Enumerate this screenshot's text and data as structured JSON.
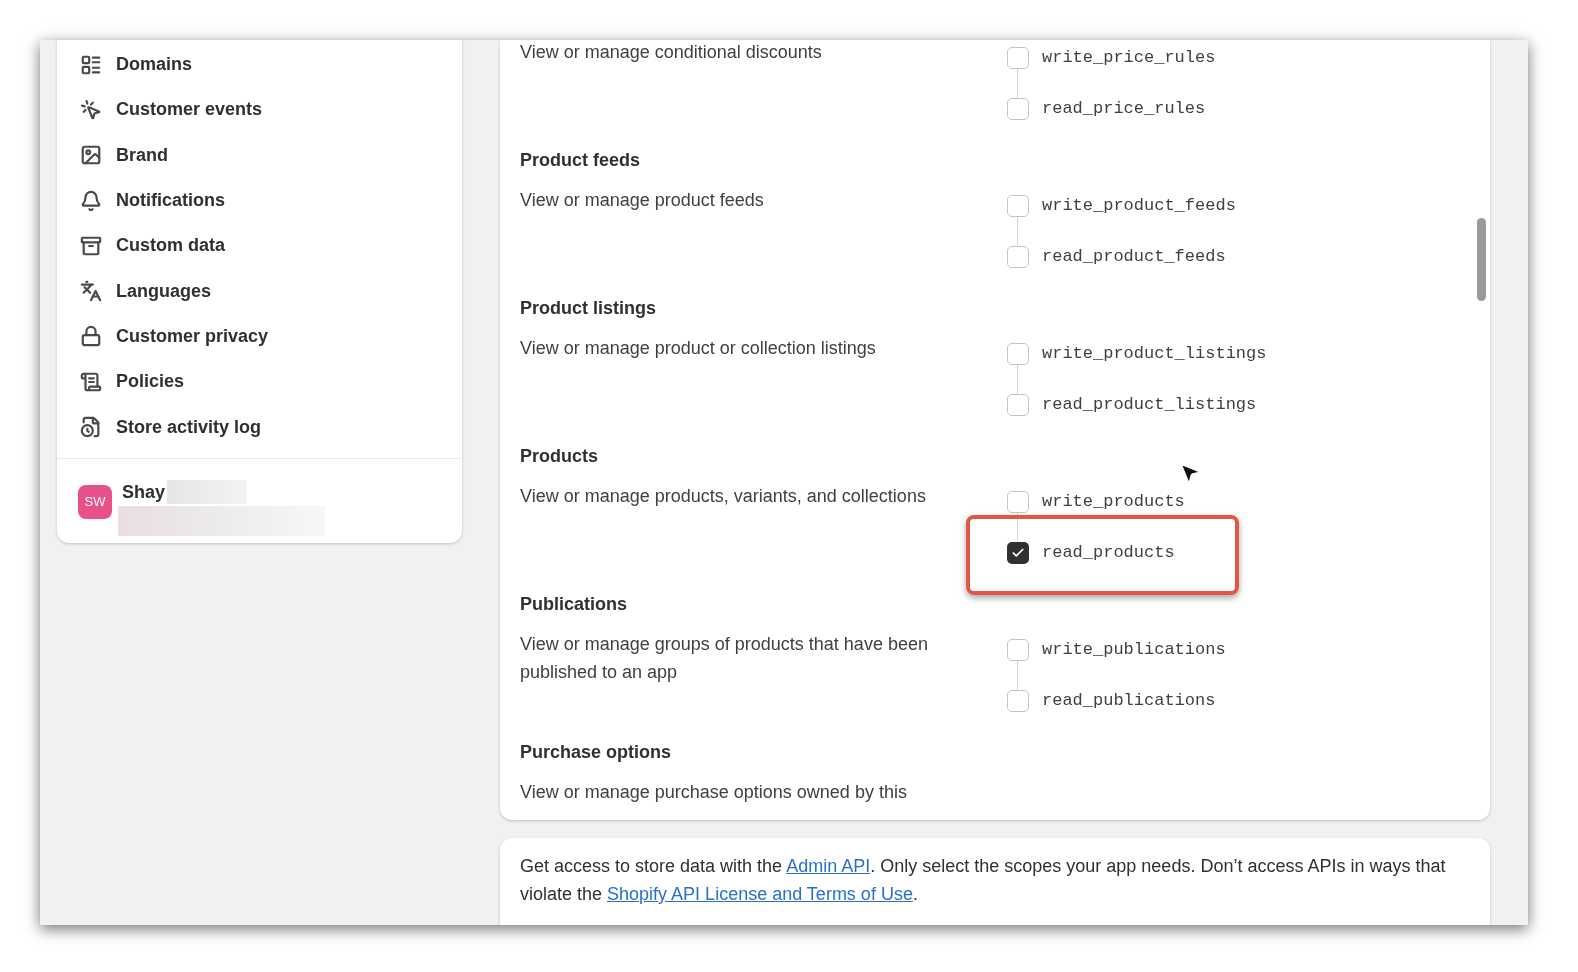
{
  "sidebar": {
    "items": [
      {
        "label": "Domains"
      },
      {
        "label": "Customer events"
      },
      {
        "label": "Brand"
      },
      {
        "label": "Notifications"
      },
      {
        "label": "Custom data"
      },
      {
        "label": "Languages"
      },
      {
        "label": "Customer privacy"
      },
      {
        "label": "Policies"
      },
      {
        "label": "Store activity log"
      }
    ],
    "user": {
      "initials": "SW",
      "name": "Shay"
    }
  },
  "sections": [
    {
      "description": "View or manage conditional discounts",
      "scopes": [
        {
          "name": "write_price_rules",
          "checked": false,
          "highlighted": false
        },
        {
          "name": "read_price_rules",
          "checked": false,
          "highlighted": false
        }
      ]
    },
    {
      "title": "Product feeds",
      "description": "View or manage product feeds",
      "scopes": [
        {
          "name": "write_product_feeds",
          "checked": false,
          "highlighted": false
        },
        {
          "name": "read_product_feeds",
          "checked": false,
          "highlighted": false
        }
      ]
    },
    {
      "title": "Product listings",
      "description": "View or manage product or collection listings",
      "scopes": [
        {
          "name": "write_product_listings",
          "checked": false,
          "highlighted": false
        },
        {
          "name": "read_product_listings",
          "checked": false,
          "highlighted": false
        }
      ]
    },
    {
      "title": "Products",
      "description": "View or manage products, variants, and collections",
      "scopes": [
        {
          "name": "write_products",
          "checked": false,
          "highlighted": false
        },
        {
          "name": "read_products",
          "checked": true,
          "highlighted": true
        }
      ]
    },
    {
      "title": "Publications",
      "description": "View or manage groups of products that have been published to an app",
      "scopes": [
        {
          "name": "write_publications",
          "checked": false,
          "highlighted": false
        },
        {
          "name": "read_publications",
          "checked": false,
          "highlighted": false
        }
      ]
    },
    {
      "title": "Purchase options",
      "description": "View or manage purchase options owned by this"
    }
  ],
  "footer": {
    "parts": [
      {
        "kind": "text",
        "text": "Get access to store data with the "
      },
      {
        "kind": "link",
        "text": "Admin API"
      },
      {
        "kind": "text",
        "text": ". Only select the scopes your app needs. Don’t access APIs in ways that violate the "
      },
      {
        "kind": "link",
        "text": "Shopify API License and Terms of Use"
      },
      {
        "kind": "text",
        "text": "."
      }
    ]
  }
}
